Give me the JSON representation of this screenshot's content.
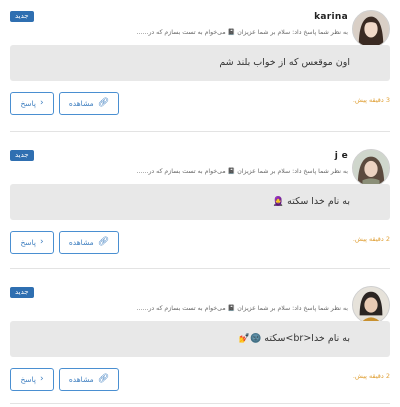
{
  "labels": {
    "new_badge": "جدید",
    "reply_button": "پاسخ",
    "view_button": "مشاهده"
  },
  "comments": [
    {
      "username": "karina",
      "reply_note": "به نظر شما پاسخ داد: سلام بر شما عزیزان 📓 می‌خوام به تست بسازم که در......",
      "message": "اون موقعس که از خواب بلند شم",
      "emoji": "",
      "time": "3 دقیقه پیش."
    },
    {
      "username": "j e",
      "reply_note": "به نظر شما پاسخ داد: سلام بر شما عزیزان 📓 می‌خوام به تست بسازم که در......",
      "message": "به نام خدا سکته",
      "emoji": "🧕",
      "time": "2 دقیقه پیش."
    },
    {
      "username": "",
      "reply_note": "به نظر شما پاسخ داد: سلام بر شما عزیزان 📓 می‌خوام به تست بسازم که در......",
      "message": "به نام خدا<br>سکته",
      "emoji": "🌚💅",
      "time": "2 دقیقه پیش."
    }
  ],
  "icons": {
    "link": "link-icon",
    "chevron": "chevron-right-icon"
  },
  "colors": {
    "badge": "#2f6fb1",
    "button": "#4a8fd1",
    "time": "#e0a23a",
    "message_bg": "#e8e8e8"
  }
}
